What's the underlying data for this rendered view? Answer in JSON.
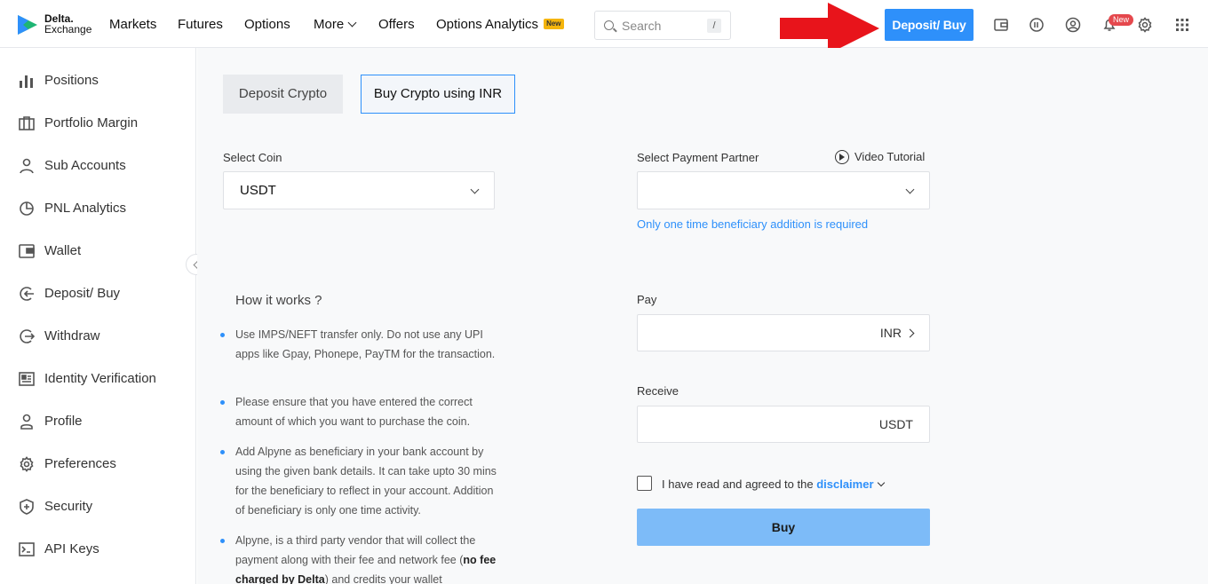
{
  "logo": {
    "line1": "Delta.",
    "line2": "Exchange"
  },
  "nav": {
    "markets": "Markets",
    "futures": "Futures",
    "options": "Options",
    "more": "More",
    "offers": "Offers",
    "options_analytics": "Options Analytics",
    "new_badge": "New"
  },
  "search": {
    "placeholder": "Search",
    "shortcut": "/"
  },
  "header": {
    "deposit_button": "Deposit/ Buy",
    "notification_badge": "New"
  },
  "sidebar": {
    "items": [
      {
        "label": "Positions",
        "icon": "bar-chart-icon"
      },
      {
        "label": "Portfolio Margin",
        "icon": "briefcase-icon"
      },
      {
        "label": "Sub Accounts",
        "icon": "user-icon"
      },
      {
        "label": "PNL Analytics",
        "icon": "pie-chart-icon"
      },
      {
        "label": "Wallet",
        "icon": "wallet-icon"
      },
      {
        "label": "Deposit/ Buy",
        "icon": "deposit-icon"
      },
      {
        "label": "Withdraw",
        "icon": "withdraw-icon"
      },
      {
        "label": "Identity Verification",
        "icon": "id-card-icon"
      },
      {
        "label": "Profile",
        "icon": "profile-icon"
      },
      {
        "label": "Preferences",
        "icon": "gear-icon"
      },
      {
        "label": "Security",
        "icon": "shield-icon"
      },
      {
        "label": "API Keys",
        "icon": "terminal-icon"
      }
    ]
  },
  "tabs": {
    "deposit_crypto": "Deposit Crypto",
    "buy_crypto_inr": "Buy Crypto using INR"
  },
  "form": {
    "select_coin_label": "Select Coin",
    "select_coin_value": "USDT",
    "payment_partner_label": "Select Payment Partner",
    "video_tutorial": "Video Tutorial",
    "beneficiary_note": "Only one time beneficiary addition is required",
    "pay_label": "Pay",
    "pay_currency": "INR",
    "receive_label": "Receive",
    "receive_currency": "USDT",
    "agree_text": "I have read and agreed to the",
    "disclaimer_link": "disclaimer",
    "buy_button": "Buy"
  },
  "how_it_works": {
    "title": "How it works ?",
    "item1": "Use IMPS/NEFT transfer only. Do not use any UPI apps like Gpay, Phonepe, PayTM for the transaction.",
    "item2": "Please ensure that you have entered the correct amount of which you want to purchase the coin.",
    "item3": "Add Alpyne as beneficiary in your bank account by using the given bank details. It can take upto 30 mins for the beneficiary to reflect in your account. Addition of beneficiary is only one time activity.",
    "item4_prefix": "Alpyne, is a third party vendor that will collect the payment along with their fee and network fee (",
    "item4_bold": "no fee charged by Delta",
    "item4_suffix": ") and credits your wallet"
  },
  "colors": {
    "accent": "#2e90fa",
    "buy_button": "#7dbbf8",
    "arrow": "#e8141b",
    "new_badge": "#f5b50c"
  }
}
